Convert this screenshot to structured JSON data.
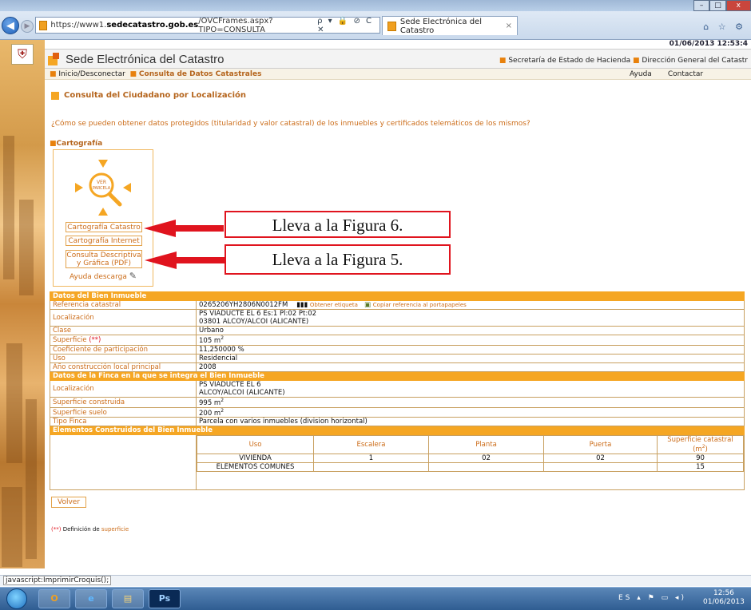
{
  "browser": {
    "url_prefix": "https://www1.",
    "url_domain": "sedecatastro.gob.es",
    "url_path": "/OVCFrames.aspx?TIPO=CONSULTA",
    "url_controls": "ρ ▾ 🔒 ⊘ C ✕",
    "tab_title": "Sede Electrónica del Catastro",
    "tab_close": "×",
    "nav_icons": "⌂ ☆ ⚙",
    "status_text": "javascript:ImprimirCroquis();"
  },
  "header": {
    "date": "01/06/2013 12:53:4",
    "site_title": "Sede Electrónica del Catastro",
    "top_right_1": "Secretaría de Estado de Hacienda",
    "top_right_2": "Dirección General del Catastr",
    "menu_home": "Inicio/Desconectar",
    "menu_consulta": "Consulta de Datos Catastrales",
    "menu_ayuda": "Ayuda",
    "menu_contactar": "Contactar"
  },
  "content": {
    "page_title": "Consulta del Ciudadano por Localización",
    "question": "¿Cómo se pueden obtener datos protegidos (titularidad y valor catastral) de los inmuebles y certificados telemáticos de los mismos?",
    "cartografia_label": "Cartografía",
    "ver_parcela": "VER PARCELA",
    "btn_cartografia_catastro": "Cartografía Catastro",
    "btn_cartografia_internet": "Cartografía Internet",
    "btn_consulta_descriptiva_1": "Consulta Descriptiva",
    "btn_consulta_descriptiva_2": "y Gráfica (PDF)",
    "ayuda_descarga": "Ayuda descarga",
    "volver": "Volver",
    "def_prefix": "(**)",
    "def_text": " Definición de ",
    "def_link": "superficie"
  },
  "annotations": {
    "anno1": "Lleva a la Figura 6.",
    "anno2": "Lleva a la Figura 5.",
    "color": "#e0141e"
  },
  "bien_inmueble": {
    "header": "Datos del Bien Inmueble",
    "ref_label": "Referencia catastral",
    "ref_value": "0265206YH2806N0012FM",
    "obtener_etiqueta": "Obtener etiqueta",
    "copiar_ref": "Copiar referencia al portapapeles",
    "loc_label": "Localización",
    "loc_line1": "PS VIADUCTE EL 6 Es:1 Pl:02 Pt:02",
    "loc_line2": "03801 ALCOY/ALCOI (ALICANTE)",
    "clase_label": "Clase",
    "clase_value": "Urbano",
    "sup_label": "Superficie ",
    "sup_mark": "(**)",
    "sup_value": "105 m",
    "coef_label": "Coeficiente de participación",
    "coef_value": "11,250000 %",
    "uso_label": "Uso",
    "uso_value": "Residencial",
    "anio_label": "Año construcción local principal",
    "anio_value": "2008"
  },
  "finca": {
    "header": "Datos de la Finca en la que se integra el Bien Inmueble",
    "loc_label": "Localización",
    "loc_line1": "PS VIADUCTE EL 6",
    "loc_line2": "ALCOY/ALCOI (ALICANTE)",
    "sc_label": "Superficie construida",
    "sc_value": "995 m",
    "ss_label": "Superficie suelo",
    "ss_value": "200 m",
    "tipo_label": "Tipo Finca",
    "tipo_value": "Parcela con varios inmuebles (division horizontal)"
  },
  "elementos": {
    "header": "Elementos Construidos del Bien Inmueble",
    "columns": [
      "Uso",
      "Escalera",
      "Planta",
      "Puerta",
      "Superficie catastral (m"
    ],
    "rows": [
      [
        "VIVIENDA",
        "1",
        "02",
        "02",
        "90"
      ],
      [
        "ELEMENTOS COMUNES",
        "",
        "",
        "",
        "15"
      ]
    ]
  },
  "taskbar": {
    "outlook": "O",
    "ie": "e",
    "files": "▤",
    "ps": "Ps",
    "tray": "ES ▴ ⚑ ▭ ◂)",
    "time": "12:56",
    "date": "01/06/2013"
  }
}
